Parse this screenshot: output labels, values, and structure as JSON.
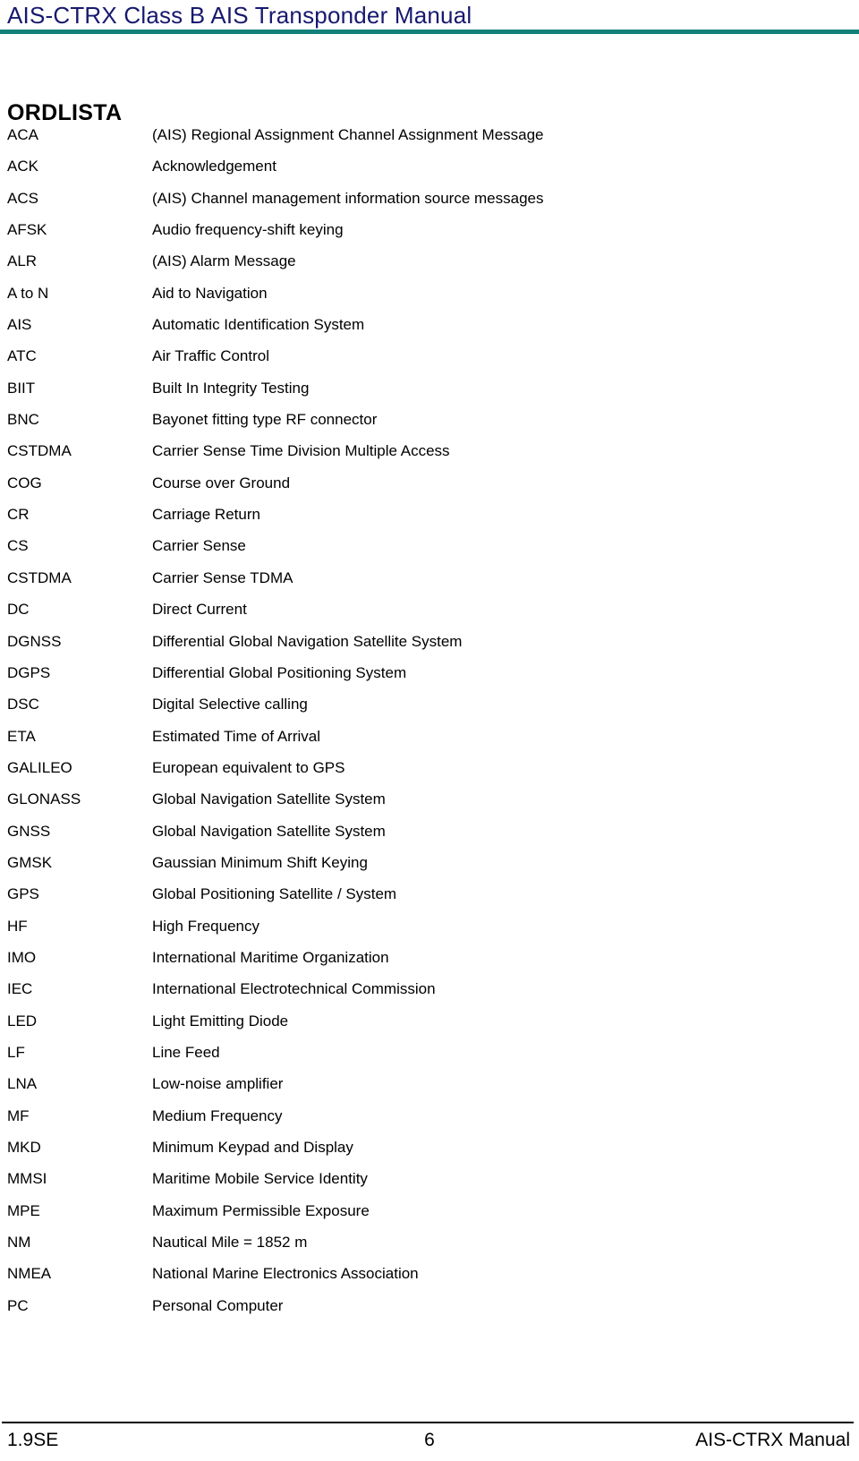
{
  "colors": {
    "header_title": "#17196e",
    "header_rule": "#14807a",
    "text": "#000000",
    "page_background": "#ffffff"
  },
  "header": {
    "title": "AIS-CTRX Class B AIS Transponder Manual"
  },
  "section": {
    "heading": "ORDLISTA"
  },
  "glossary": {
    "entries": [
      {
        "term": "ACA",
        "definition": "(AIS) Regional Assignment Channel Assignment Message"
      },
      {
        "term": "ACK",
        "definition": "Acknowledgement"
      },
      {
        "term": "ACS",
        "definition": "(AIS) Channel management information source messages"
      },
      {
        "term": "AFSK",
        "definition": "Audio frequency-shift keying"
      },
      {
        "term": "ALR",
        "definition": "(AIS) Alarm Message"
      },
      {
        "term": "A to N",
        "definition": "Aid to Navigation"
      },
      {
        "term": "AIS",
        "definition": "Automatic Identification System"
      },
      {
        "term": "ATC",
        "definition": "Air Traffic Control"
      },
      {
        "term": "BIIT",
        "definition": "Built In Integrity Testing"
      },
      {
        "term": "BNC",
        "definition": "Bayonet fitting type RF connector"
      },
      {
        "term": "CSTDMA",
        "definition": "Carrier Sense Time Division Multiple Access"
      },
      {
        "term": "COG",
        "definition": "Course over Ground"
      },
      {
        "term": "CR",
        "definition": "Carriage Return"
      },
      {
        "term": "CS",
        "definition": "Carrier Sense"
      },
      {
        "term": "CSTDMA",
        "definition": "Carrier Sense TDMA"
      },
      {
        "term": "DC",
        "definition": "Direct Current"
      },
      {
        "term": "DGNSS",
        "definition": "Differential Global Navigation Satellite System"
      },
      {
        "term": "DGPS",
        "definition": "Differential Global Positioning System"
      },
      {
        "term": "DSC",
        "definition": "Digital Selective calling"
      },
      {
        "term": "ETA",
        "definition": "Estimated Time of Arrival"
      },
      {
        "term": "GALILEO",
        "definition": "European equivalent to GPS"
      },
      {
        "term": "GLONASS",
        "definition": "Global Navigation Satellite System"
      },
      {
        "term": "GNSS",
        "definition": "Global Navigation Satellite System"
      },
      {
        "term": "GMSK",
        "definition": "Gaussian Minimum Shift Keying"
      },
      {
        "term": "GPS",
        "definition": "Global Positioning Satellite / System"
      },
      {
        "term": "HF",
        "definition": "High Frequency"
      },
      {
        "term": "IMO",
        "definition": "International Maritime Organization"
      },
      {
        "term": "IEC",
        "definition": "International Electrotechnical Commission"
      },
      {
        "term": "LED",
        "definition": "Light Emitting Diode"
      },
      {
        "term": "LF",
        "definition": "Line Feed"
      },
      {
        "term": "LNA",
        "definition": "Low-noise amplifier"
      },
      {
        "term": "MF",
        "definition": "Medium Frequency"
      },
      {
        "term": "MKD",
        "definition": "Minimum Keypad and Display"
      },
      {
        "term": "MMSI",
        "definition": "Maritime Mobile Service Identity"
      },
      {
        "term": "MPE",
        "definition": "Maximum Permissible Exposure"
      },
      {
        "term": "NM",
        "definition": "Nautical Mile = 1852 m"
      },
      {
        "term": "NMEA",
        "definition": "National Marine Electronics Association"
      },
      {
        "term": "PC",
        "definition": "Personal Computer"
      }
    ]
  },
  "footer": {
    "version": "1.9SE",
    "page_number": "6",
    "document_name": "AIS-CTRX Manual"
  }
}
